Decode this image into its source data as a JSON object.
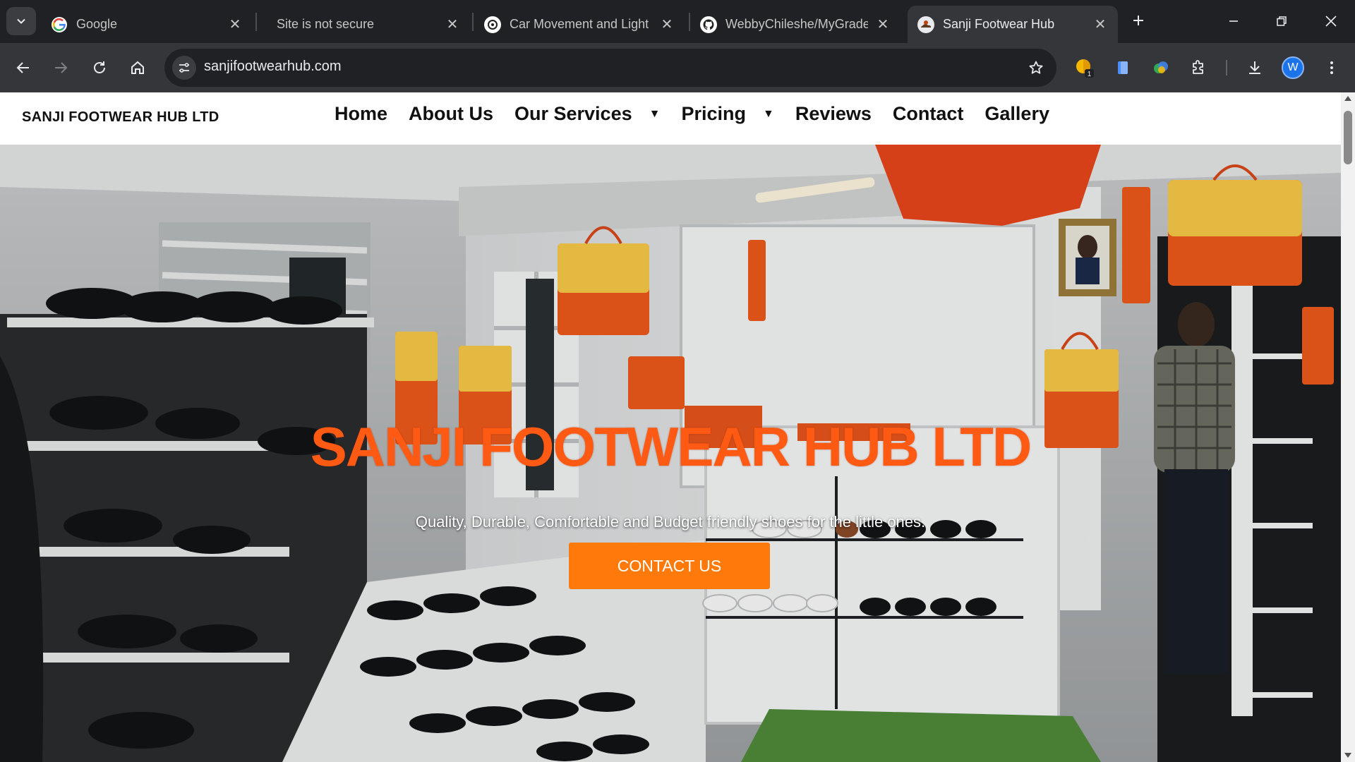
{
  "browser": {
    "tabs": [
      {
        "title": "Google",
        "icon": "google-icon",
        "active": false
      },
      {
        "title": "Site is not secure",
        "icon": "",
        "active": false
      },
      {
        "title": "Car Movement and Light",
        "icon": "openai-icon",
        "active": false
      },
      {
        "title": "WebbyChileshe/MyGrade",
        "icon": "github-icon",
        "active": false
      },
      {
        "title": "Sanji Footwear Hub",
        "icon": "site-favicon",
        "active": true
      }
    ],
    "url": "sanjifootwearhub.com",
    "profile_initial": "W",
    "extension_badge": "1"
  },
  "site": {
    "logo_text": "SANJI FOOTWEAR HUB LTD",
    "nav": [
      {
        "label": "Home"
      },
      {
        "label": "About Us"
      },
      {
        "label": "Our Services",
        "has_dropdown": true
      },
      {
        "label": "Pricing",
        "has_dropdown": true
      },
      {
        "label": "Reviews"
      },
      {
        "label": "Contact"
      },
      {
        "label": "Gallery"
      }
    ],
    "hero": {
      "title": "SANJI FOOTWEAR HUB LTD",
      "subtitle": "Quality, Durable, Comfortable and Budget friendly shoes for the little ones.",
      "cta_label": "CONTACT US"
    },
    "dropdown_caret": "▼"
  },
  "colors": {
    "accent": "#ff7a0a",
    "hero_title": "#ff5a14",
    "browser_bg": "#202124",
    "toolbar_bg": "#35363a"
  }
}
